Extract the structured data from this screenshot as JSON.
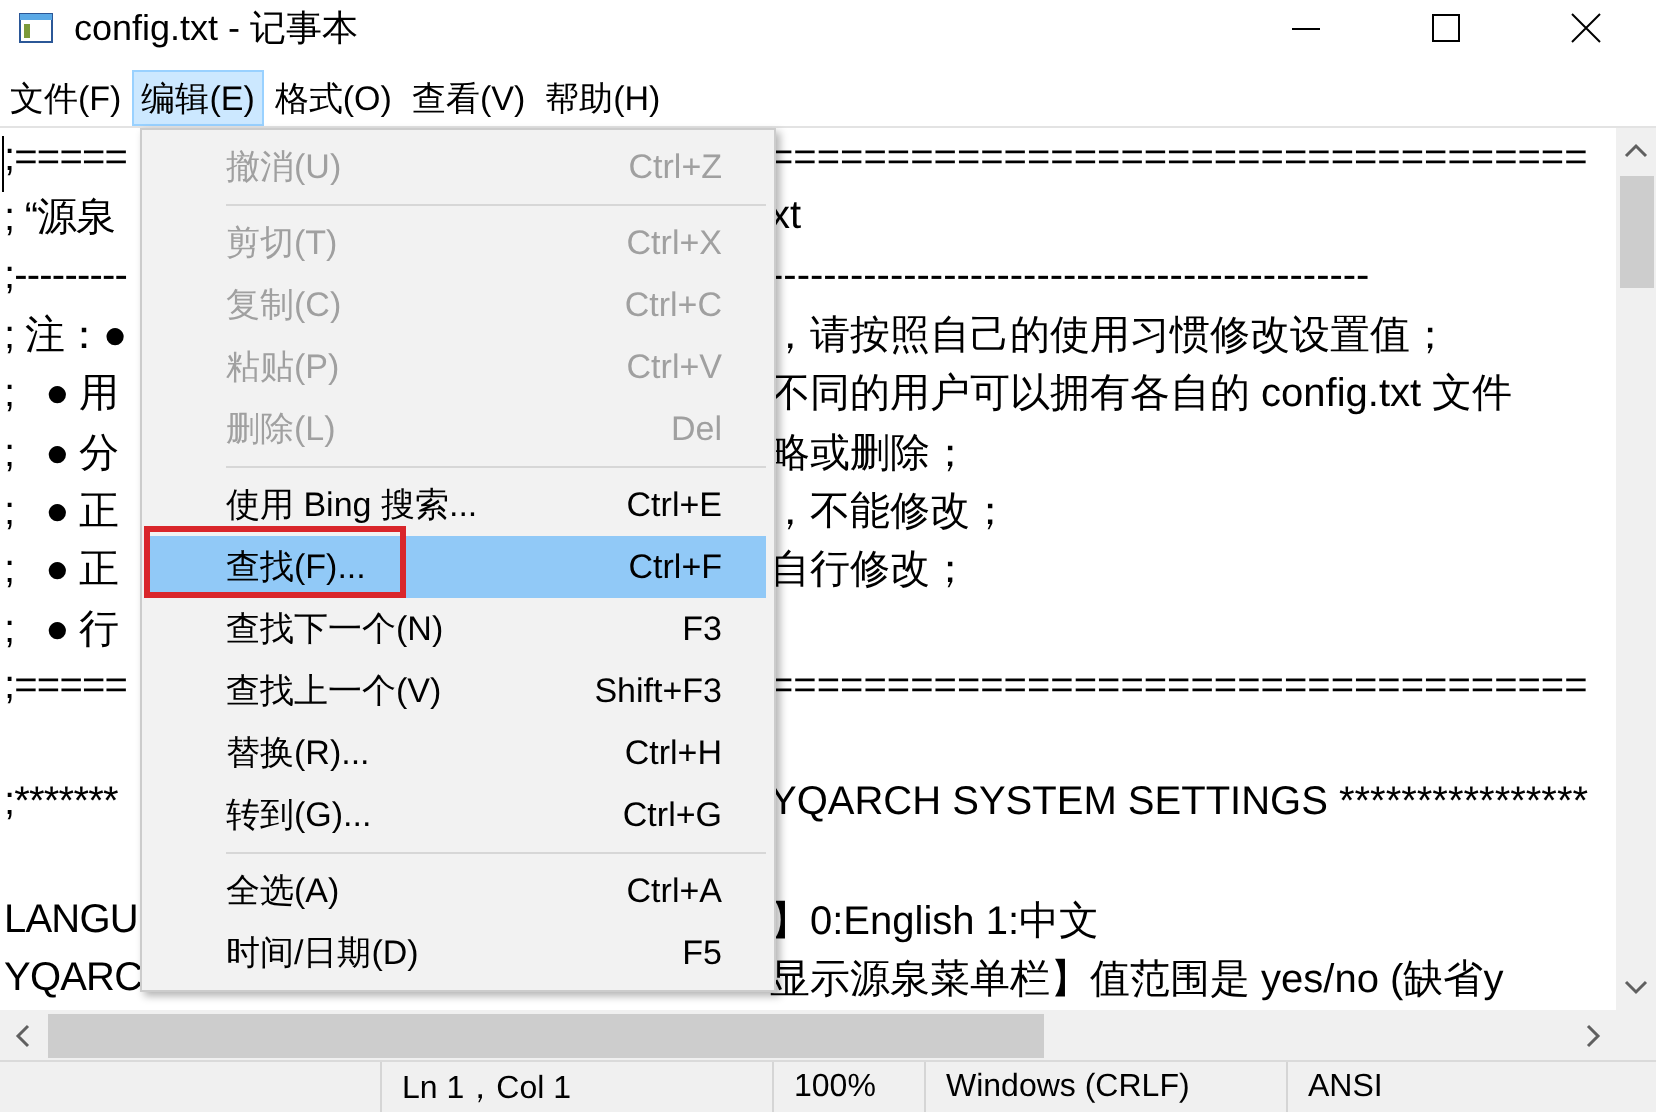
{
  "window": {
    "title": "config.txt - 记事本"
  },
  "menubar": [
    {
      "label": "文件(F)",
      "selected": false
    },
    {
      "label": "编辑(E)",
      "selected": true
    },
    {
      "label": "格式(O)",
      "selected": false
    },
    {
      "label": "查看(V)",
      "selected": false
    },
    {
      "label": "帮助(H)",
      "selected": false
    }
  ],
  "editor_lines": [
    {
      "kind": "text",
      "left": ";=====",
      "right": "==================================="
    },
    {
      "kind": "text",
      "left": "; “源泉",
      "right": "xt"
    },
    {
      "kind": "text",
      "left": ";---------",
      "right": "---------------------------------------------"
    },
    {
      "kind": "text",
      "left": "; 注：●",
      "right": "，请按照自己的使用习惯修改设置值；"
    },
    {
      "kind": "text",
      "left": ";   ● 用",
      "right": "不同的用户可以拥有各自的 config.txt 文件"
    },
    {
      "kind": "text",
      "left": ";   ● 分",
      "right": "略或删除；"
    },
    {
      "kind": "text",
      "left": ";   ● 正",
      "right": "，不能修改；"
    },
    {
      "kind": "text",
      "left": ";   ● 正",
      "right": "自行修改；"
    },
    {
      "kind": "text",
      "left": ";   ● 行"
    },
    {
      "kind": "text",
      "left": ";=====",
      "right": "==================================="
    },
    {
      "kind": "blank"
    },
    {
      "kind": "text",
      "left": ";*******",
      "right": "YQARCH SYSTEM SETTINGS ****************"
    },
    {
      "kind": "blank"
    },
    {
      "kind": "text",
      "left": "LANGU",
      "right": "】0:English 1:中文"
    },
    {
      "kind": "text",
      "left": "YQARC",
      "right": "显示源泉菜单栏】值范围是 yes/no (缺省y"
    }
  ],
  "edit_menu": [
    {
      "kind": "item",
      "label": "撤消(U)",
      "shortcut": "Ctrl+Z",
      "disabled": true,
      "selected": false,
      "outlined": false
    },
    {
      "kind": "separator"
    },
    {
      "kind": "item",
      "label": "剪切(T)",
      "shortcut": "Ctrl+X",
      "disabled": true,
      "selected": false,
      "outlined": false
    },
    {
      "kind": "item",
      "label": "复制(C)",
      "shortcut": "Ctrl+C",
      "disabled": true,
      "selected": false,
      "outlined": false
    },
    {
      "kind": "item",
      "label": "粘贴(P)",
      "shortcut": "Ctrl+V",
      "disabled": true,
      "selected": false,
      "outlined": false
    },
    {
      "kind": "item",
      "label": "删除(L)",
      "shortcut": "Del",
      "disabled": true,
      "selected": false,
      "outlined": false
    },
    {
      "kind": "separator"
    },
    {
      "kind": "item",
      "label": "使用 Bing 搜索...",
      "shortcut": "Ctrl+E",
      "disabled": false,
      "selected": false,
      "outlined": false
    },
    {
      "kind": "item",
      "label": "查找(F)...",
      "shortcut": "Ctrl+F",
      "disabled": false,
      "selected": true,
      "outlined": true
    },
    {
      "kind": "item",
      "label": "查找下一个(N)",
      "shortcut": "F3",
      "disabled": false,
      "selected": false,
      "outlined": false
    },
    {
      "kind": "item",
      "label": "查找上一个(V)",
      "shortcut": "Shift+F3",
      "disabled": false,
      "selected": false,
      "outlined": false
    },
    {
      "kind": "item",
      "label": "替换(R)...",
      "shortcut": "Ctrl+H",
      "disabled": false,
      "selected": false,
      "outlined": false
    },
    {
      "kind": "item",
      "label": "转到(G)...",
      "shortcut": "Ctrl+G",
      "disabled": false,
      "selected": false,
      "outlined": false
    },
    {
      "kind": "separator"
    },
    {
      "kind": "item",
      "label": "全选(A)",
      "shortcut": "Ctrl+A",
      "disabled": false,
      "selected": false,
      "outlined": false
    },
    {
      "kind": "item",
      "label": "时间/日期(D)",
      "shortcut": "F5",
      "disabled": false,
      "selected": false,
      "outlined": false
    }
  ],
  "status_bar": [
    "Ln 1，Col 1",
    "100%",
    "Windows (CRLF)",
    "ANSI"
  ]
}
